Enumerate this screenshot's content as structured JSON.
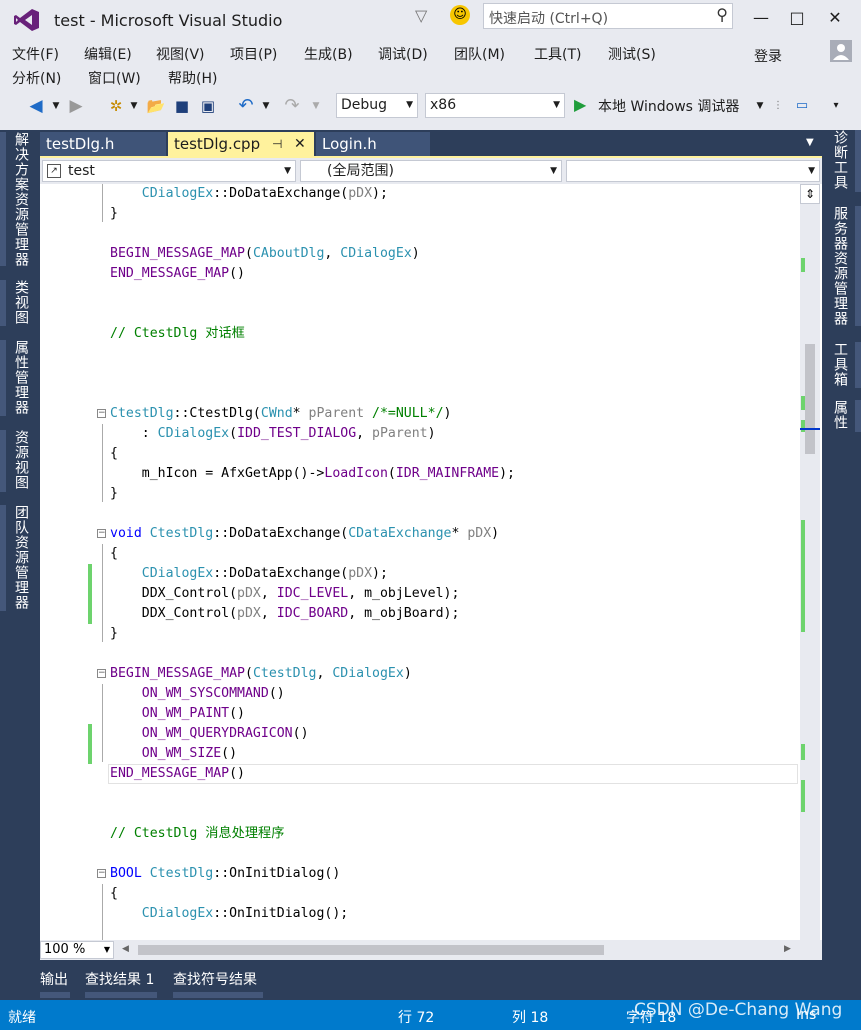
{
  "window": {
    "title": "test - Microsoft Visual Studio",
    "quick_launch_placeholder": "快速启动 (Ctrl+Q)",
    "sign_in": "登录",
    "min": "—",
    "max": "□",
    "close": "✕"
  },
  "menu": {
    "row1": [
      "文件(F)",
      "编辑(E)",
      "视图(V)",
      "项目(P)",
      "生成(B)",
      "调试(D)",
      "团队(M)",
      "工具(T)",
      "测试(S)"
    ],
    "row2": [
      "分析(N)",
      "窗口(W)",
      "帮助(H)"
    ]
  },
  "toolbar": {
    "config": "Debug",
    "platform": "x86",
    "run_label": "本地 Windows 调试器"
  },
  "doc_tabs": [
    "testDlg.h",
    "testDlg.cpp",
    "Login.h"
  ],
  "active_tab_pin": "⊣",
  "active_tab_close": "✕",
  "nav": {
    "project": "test",
    "scope": "(全局范围)",
    "member": ""
  },
  "left_panels": [
    "解决方案资源管理器",
    "类视图",
    "属性管理器",
    "资源视图",
    "团队资源管理器"
  ],
  "right_panels": [
    "诊断工具",
    "服务器资源管理器",
    "工具箱",
    "属性"
  ],
  "code": {
    "l1_a": "CDialogEx",
    "l1_b": "::DoDataExchange(",
    "l1_c": "pDX",
    "l1_d": ");",
    "l2": "}",
    "l3_a": "BEGIN_MESSAGE_MAP",
    "l3_b": "(",
    "l3_c": "CAboutDlg",
    "l3_d": ", ",
    "l3_e": "CDialogEx",
    "l3_f": ")",
    "l4_a": "END_MESSAGE_MAP",
    "l4_b": "()",
    "l5": "// CtestDlg 对话框",
    "l6_a": "CtestDlg",
    "l6_b": "::CtestDlg(",
    "l6_c": "CWnd",
    "l6_d": "* ",
    "l6_e": "pParent",
    "l6_f": " /*=NULL*/",
    "l6_g": ")",
    "l7_a": "    : ",
    "l7_b": "CDialogEx",
    "l7_c": "(",
    "l7_d": "IDD_TEST_DIALOG",
    "l7_e": ", ",
    "l7_f": "pParent",
    "l7_g": ")",
    "l8": "{",
    "l9_a": "    m_hIcon = AfxGetApp()->",
    "l9_b": "LoadIcon",
    "l9_c": "(",
    "l9_d": "IDR_MAINFRAME",
    "l9_e": ");",
    "l10": "}",
    "l11_a": "void",
    "l11_b": " ",
    "l11_c": "CtestDlg",
    "l11_d": "::DoDataExchange(",
    "l11_e": "CDataExchange",
    "l11_f": "* ",
    "l11_g": "pDX",
    "l11_h": ")",
    "l12": "{",
    "l13_a": "    ",
    "l13_b": "CDialogEx",
    "l13_c": "::DoDataExchange(",
    "l13_d": "pDX",
    "l13_e": ");",
    "l14_a": "    DDX_Control(",
    "l14_b": "pDX",
    "l14_c": ", ",
    "l14_d": "IDC_LEVEL",
    "l14_e": ", m_objLevel);",
    "l15_a": "    DDX_Control(",
    "l15_b": "pDX",
    "l15_c": ", ",
    "l15_d": "IDC_BOARD",
    "l15_e": ", m_objBoard);",
    "l16": "}",
    "l17_a": "BEGIN_MESSAGE_MAP",
    "l17_b": "(",
    "l17_c": "CtestDlg",
    "l17_d": ", ",
    "l17_e": "CDialogEx",
    "l17_f": ")",
    "l18_a": "    ",
    "l18_b": "ON_WM_SYSCOMMAND",
    "l18_c": "()",
    "l19_a": "    ",
    "l19_b": "ON_WM_PAINT",
    "l19_c": "()",
    "l20_a": "    ",
    "l20_b": "ON_WM_QUERYDRAGICON",
    "l20_c": "()",
    "l21_a": "    ",
    "l21_b": "ON_WM_SIZE",
    "l21_c": "()",
    "l22_a": "END_MESSAGE_MAP",
    "l22_b": "()",
    "l23": "// CtestDlg 消息处理程序",
    "l24_a": "BOOL",
    "l24_b": " ",
    "l24_c": "CtestDlg",
    "l24_d": "::OnInitDialog()",
    "l25": "{",
    "l26_a": "    ",
    "l26_b": "CDialogEx",
    "l26_c": "::OnInitDialog();"
  },
  "zoom": "100 %",
  "bottom_tabs": [
    "输出",
    "查找结果 1",
    "查找符号结果"
  ],
  "status": {
    "ready": "就绪",
    "line": "行 72",
    "col": "列 18",
    "char": "字符 18",
    "ins": "Ins"
  },
  "watermark": "CSDN @De-Chang Wang",
  "colors": {
    "accent": "#007acc",
    "chrome": "#e8eaf0",
    "panel": "#2d3e5a",
    "active_tab": "#fff29d",
    "keyword": "#0000ff",
    "type": "#2b91af",
    "macro": "#6f008a",
    "comment": "#008000",
    "change_marker": "#6dd36d"
  }
}
